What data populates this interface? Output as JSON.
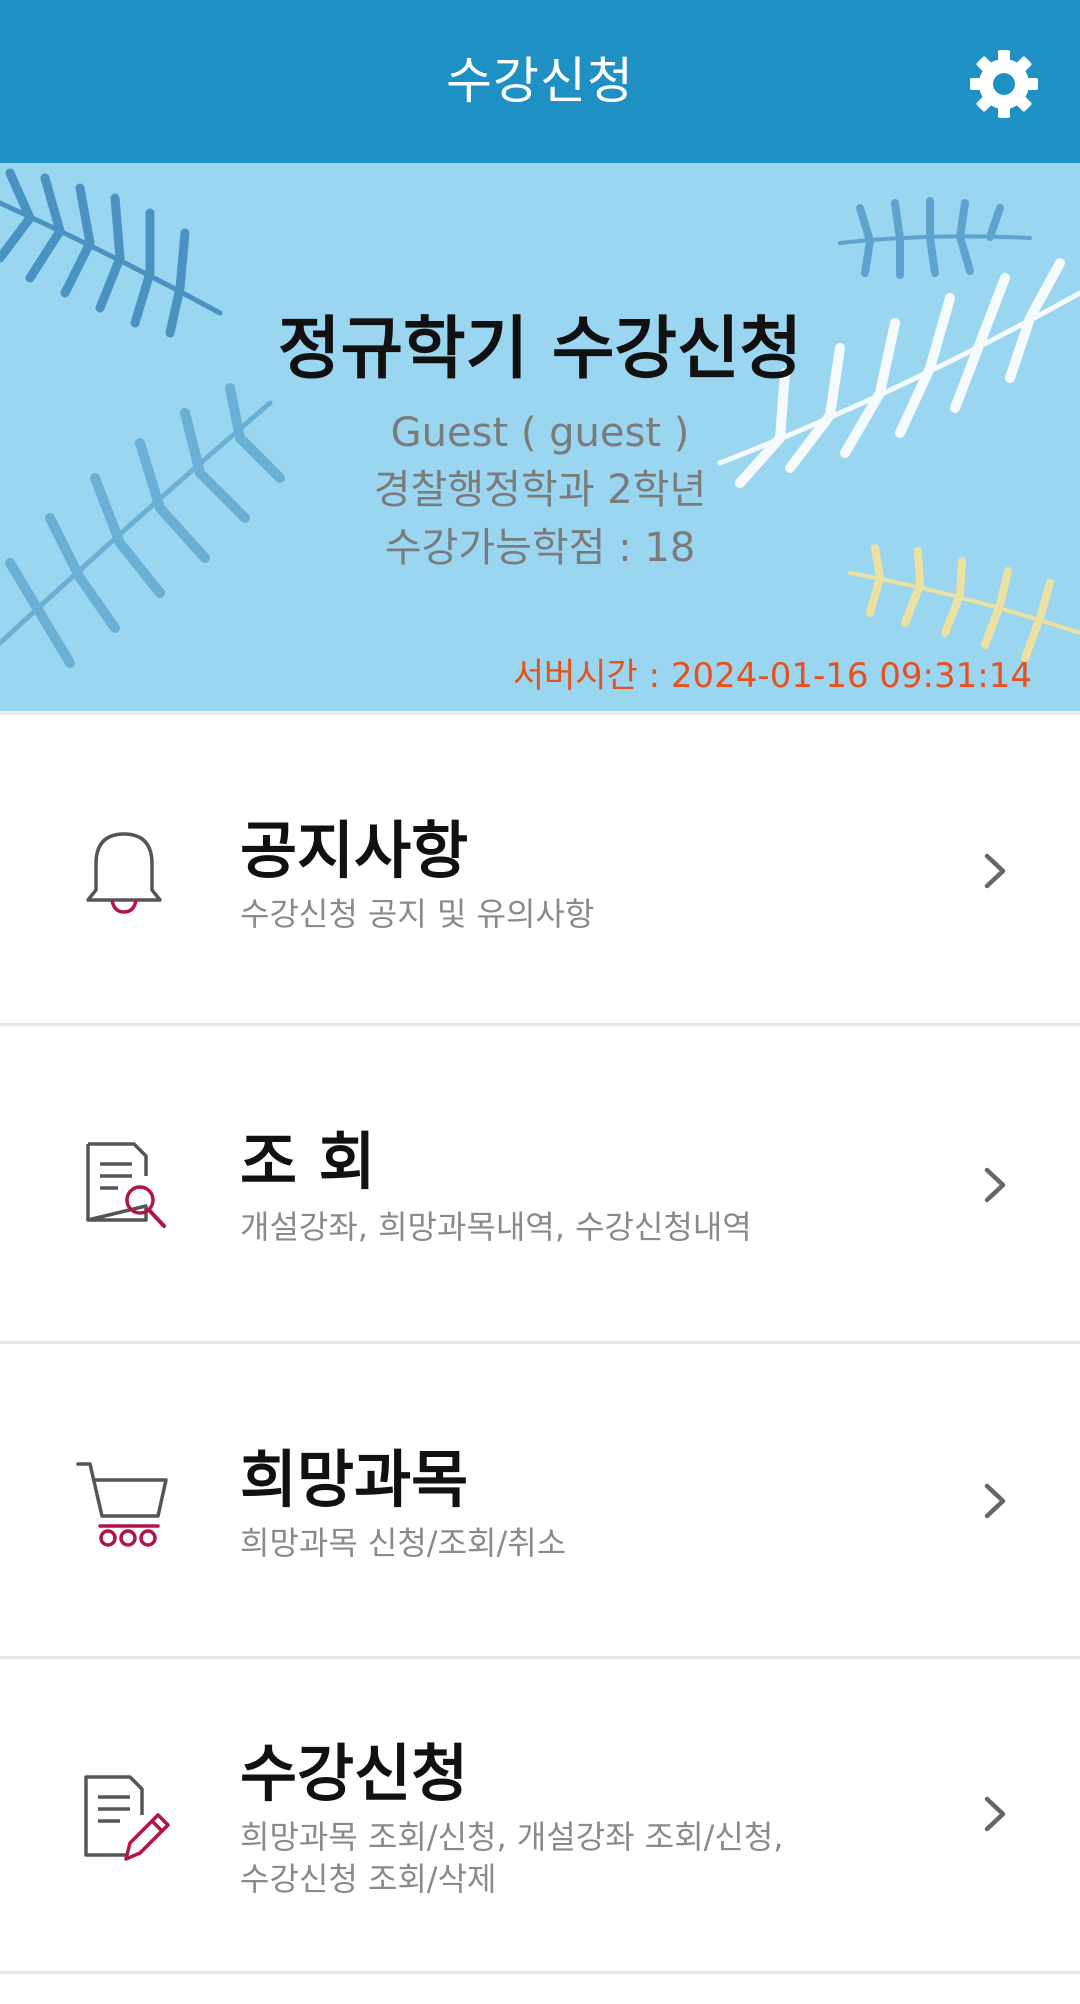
{
  "header": {
    "title": "수강신청",
    "settings_icon": "gear-icon"
  },
  "banner": {
    "heading": "정규학기 수강신청",
    "user": "Guest ( guest )",
    "department": "경찰행정학과  2학년",
    "credits": "수강가능학점 : 18",
    "server_time": "서버시간 : 2024-01-16 09:31:14"
  },
  "menu": {
    "items": [
      {
        "title": "공지사항",
        "description": "수강신청 공지 및 유의사항",
        "icon": "bell-icon"
      },
      {
        "title": "조   회",
        "description": "개설강좌, 희망과목내역, 수강신청내역",
        "icon": "document-search-icon"
      },
      {
        "title": "희망과목",
        "description": "희망과목 신청/조회/취소",
        "icon": "cart-icon"
      },
      {
        "title": "수강신청",
        "description": "희망과목 조회/신청, 개설강좌 조회/신청,",
        "description2": "수강신청 조회/삭제",
        "icon": "document-edit-icon"
      }
    ]
  },
  "colors": {
    "header_bg": "#1e90c4",
    "banner_bg": "#9bd6f1",
    "server_time": "#e8501d",
    "icon_accent": "#b3124a",
    "icon_gray": "#555555"
  }
}
